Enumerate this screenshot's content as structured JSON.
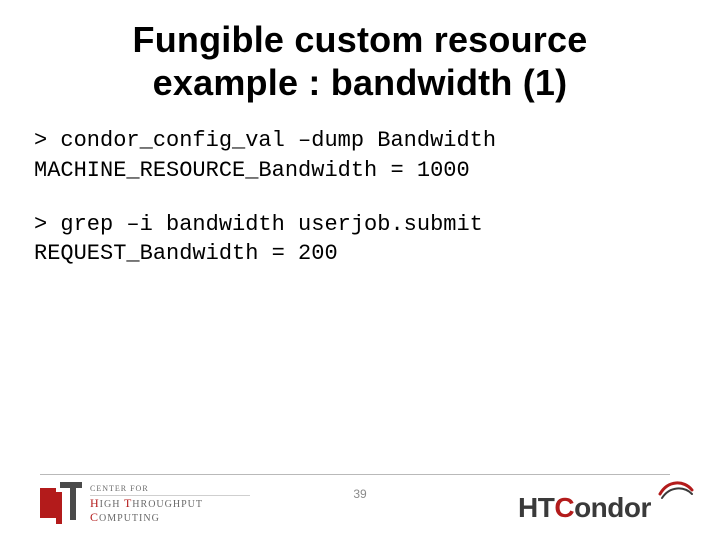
{
  "title_lines": [
    "Fungible custom resource",
    "example : bandwidth (1)"
  ],
  "code_blocks": [
    [
      "> condor_config_val –dump Bandwidth",
      "MACHINE_RESOURCE_Bandwidth = 1000"
    ],
    [
      "> grep –i bandwidth userjob.submit",
      "REQUEST_Bandwidth = 200"
    ]
  ],
  "page_number": "39",
  "left_logo": {
    "line1": "CENTER FOR",
    "line2_prefix_big": "H",
    "line2_rest": "IGH ",
    "line2_prefix_big2": "T",
    "line2_rest2": "HROUGHPUT",
    "line3_prefix_big": "C",
    "line3_rest": "OMPUTING"
  },
  "right_logo": {
    "part1": "HT",
    "part2_colored": "C",
    "part3": "ondor"
  }
}
